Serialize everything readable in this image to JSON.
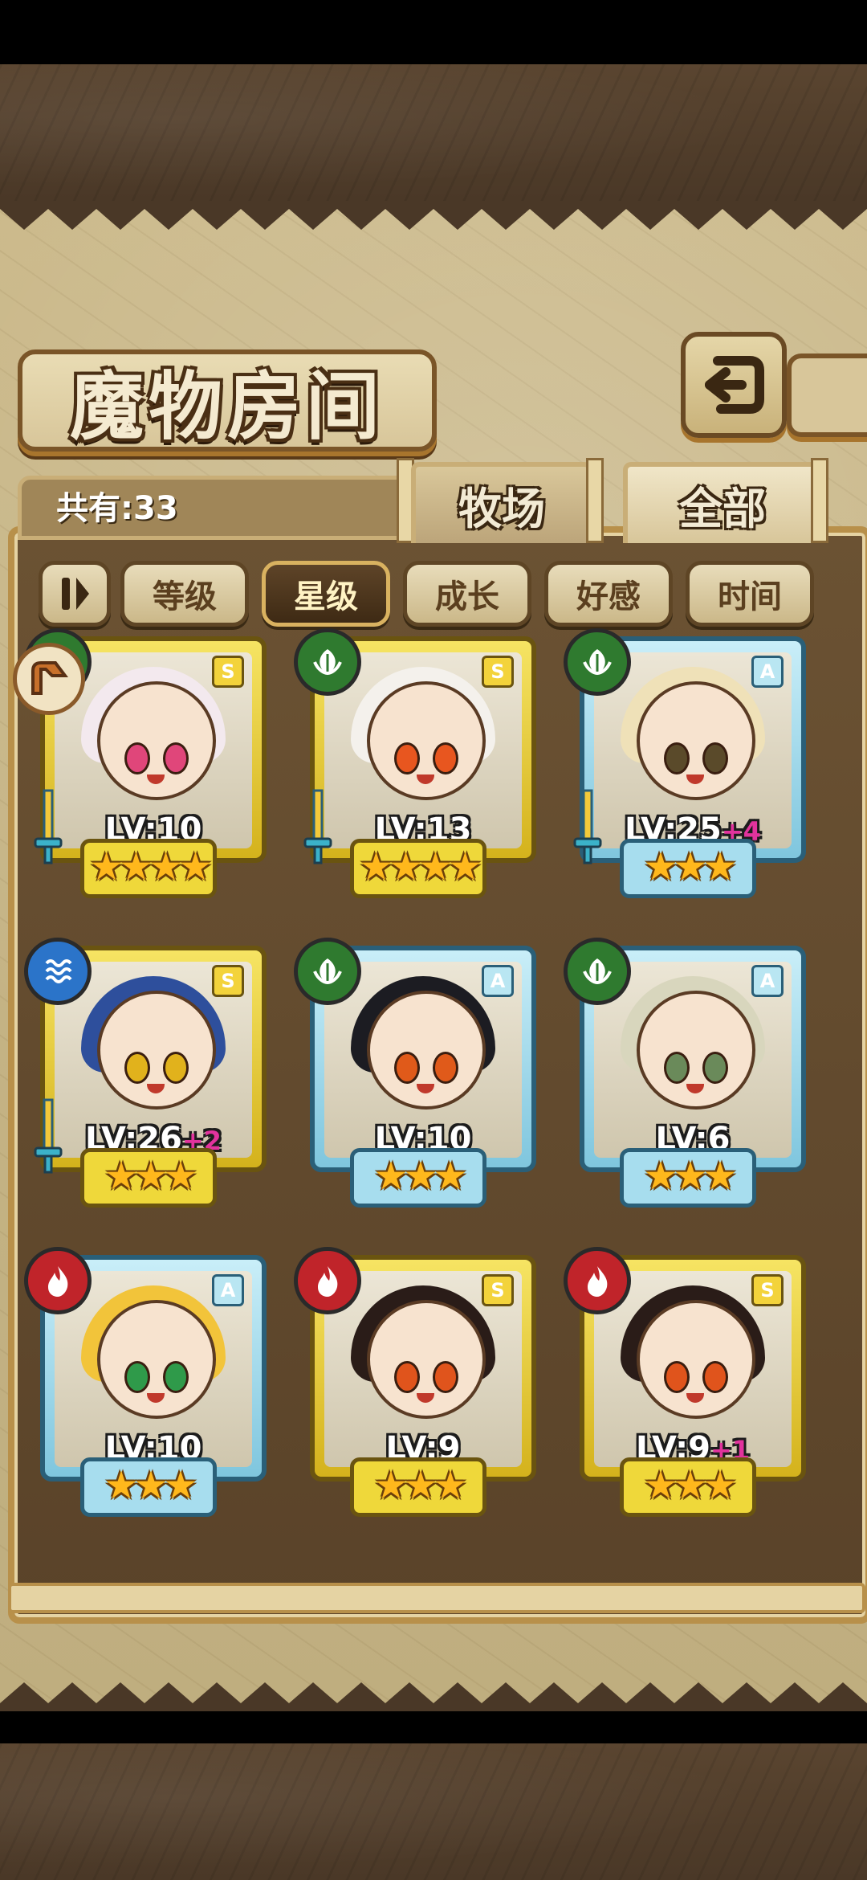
{
  "header": {
    "title": "魔物房间",
    "back_icon": "return-icon"
  },
  "summary": {
    "count_label": "共有:33"
  },
  "tabs": [
    {
      "label": "牧场",
      "active": false
    },
    {
      "label": "全部",
      "active": true
    }
  ],
  "sort_buttons": [
    {
      "label": "等级",
      "active": false
    },
    {
      "label": "星级",
      "active": true
    },
    {
      "label": "成长",
      "active": false
    },
    {
      "label": "好感",
      "active": false
    },
    {
      "label": "时间",
      "active": false
    }
  ],
  "monsters": [
    {
      "element": "leaf",
      "rank": "S",
      "frame": "gold",
      "level": "LV:10",
      "bonus": "",
      "stars": "★★★★",
      "weapon": true,
      "hair": "#f3e9ee",
      "eyes": "#e0467a"
    },
    {
      "element": "leaf",
      "rank": "S",
      "frame": "gold",
      "level": "LV:13",
      "bonus": "",
      "stars": "★★★★",
      "weapon": true,
      "hair": "#f4f1ec",
      "eyes": "#e8561f"
    },
    {
      "element": "leaf",
      "rank": "A",
      "frame": "blue",
      "level": "LV:25",
      "bonus": "+4",
      "stars": "★★★",
      "weapon": true,
      "hair": "#efe1b8",
      "eyes": "#5a4a2a"
    },
    {
      "element": "water",
      "rank": "S",
      "frame": "gold",
      "level": "LV:26",
      "bonus": "+2",
      "stars": "★★★",
      "weapon": true,
      "hair": "#2e4f9c",
      "eyes": "#e1b21c"
    },
    {
      "element": "leaf",
      "rank": "A",
      "frame": "blue",
      "level": "LV:10",
      "bonus": "",
      "stars": "★★★",
      "weapon": false,
      "hair": "#1c1c22",
      "eyes": "#e05a1a"
    },
    {
      "element": "leaf",
      "rank": "A",
      "frame": "blue",
      "level": "LV:6",
      "bonus": "",
      "stars": "★★★",
      "weapon": false,
      "hair": "#d8d6bd",
      "eyes": "#6a8a5a"
    },
    {
      "element": "fire",
      "rank": "A",
      "frame": "blue",
      "level": "LV:10",
      "bonus": "",
      "stars": "★★★",
      "weapon": false,
      "hair": "#f2c43a",
      "eyes": "#2f9a4a"
    },
    {
      "element": "fire",
      "rank": "S",
      "frame": "gold",
      "level": "LV:9",
      "bonus": "",
      "stars": "★★★",
      "weapon": false,
      "hair": "#2a1c18",
      "eyes": "#e0541c"
    },
    {
      "element": "fire",
      "rank": "S",
      "frame": "gold",
      "level": "LV:9",
      "bonus": "+1",
      "stars": "★★★",
      "weapon": false,
      "hair": "#2a1c18",
      "eyes": "#e0541c"
    }
  ],
  "colors": {
    "board": "#c6b385",
    "panel": "#6b5233",
    "accent_gold": "#e8c84a",
    "bonus_pink": "#e2339d"
  }
}
